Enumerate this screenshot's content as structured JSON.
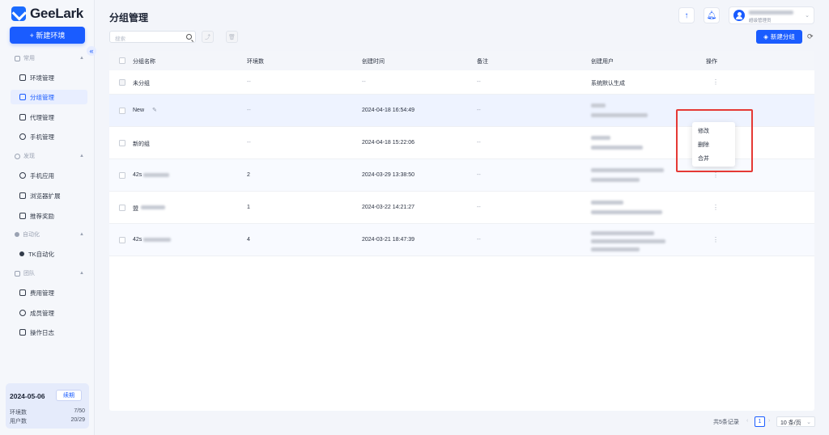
{
  "app": {
    "logo_text": "GeeLark",
    "new_env_label": "+ 新建环境",
    "collapse_glyph": "«"
  },
  "sidebar": {
    "sections": [
      {
        "label": "常用",
        "items": [
          "环境管理",
          "分组管理",
          "代理管理",
          "手机管理"
        ]
      },
      {
        "label": "发现",
        "items": [
          "手机应用",
          "浏览器扩展",
          "推荐奖励"
        ]
      },
      {
        "label": "自动化",
        "items": [
          "TK自动化"
        ]
      },
      {
        "label": "团队",
        "items": [
          "费用管理",
          "成员管理",
          "操作日志"
        ]
      }
    ],
    "active_item": "分组管理"
  },
  "plan": {
    "date": "2024-05-06",
    "renew_label": "续期",
    "env_label": "环境数",
    "env_value": "7/50",
    "user_label": "用户数",
    "user_value": "20/29"
  },
  "header": {
    "title": "分组管理",
    "user_role": "超级管理员"
  },
  "toolbar": {
    "search_placeholder": "搜索",
    "new_group_label": "新建分组"
  },
  "table": {
    "columns": [
      "分组名称",
      "环境数",
      "创建时间",
      "备注",
      "创建用户",
      "操作"
    ],
    "rows": [
      {
        "name": "未分组",
        "env": "--",
        "time": "--",
        "note": "--",
        "user": "系统默认生成"
      },
      {
        "name": "New",
        "env": "--",
        "time": "2024-04-18 16:54:49",
        "note": "--",
        "user": ""
      },
      {
        "name": "新的组",
        "env": "--",
        "time": "2024-04-18 15:22:06",
        "note": "--",
        "user": ""
      },
      {
        "name": "42s",
        "env": "2",
        "time": "2024-03-29 13:38:50",
        "note": "--",
        "user": ""
      },
      {
        "name": "盟",
        "env": "1",
        "time": "2024-03-22 14:21:27",
        "note": "--",
        "user": ""
      },
      {
        "name": "42s",
        "env": "4",
        "time": "2024-03-21 18:47:39",
        "note": "--",
        "user": ""
      }
    ]
  },
  "context_menu": {
    "items": [
      "修改",
      "删除",
      "合并"
    ]
  },
  "pagination": {
    "total": "共5条记录",
    "current_page": "1",
    "page_size": "10 条/页"
  },
  "colors": {
    "accent": "#1a5cff",
    "highlight_box": "#e53935"
  }
}
